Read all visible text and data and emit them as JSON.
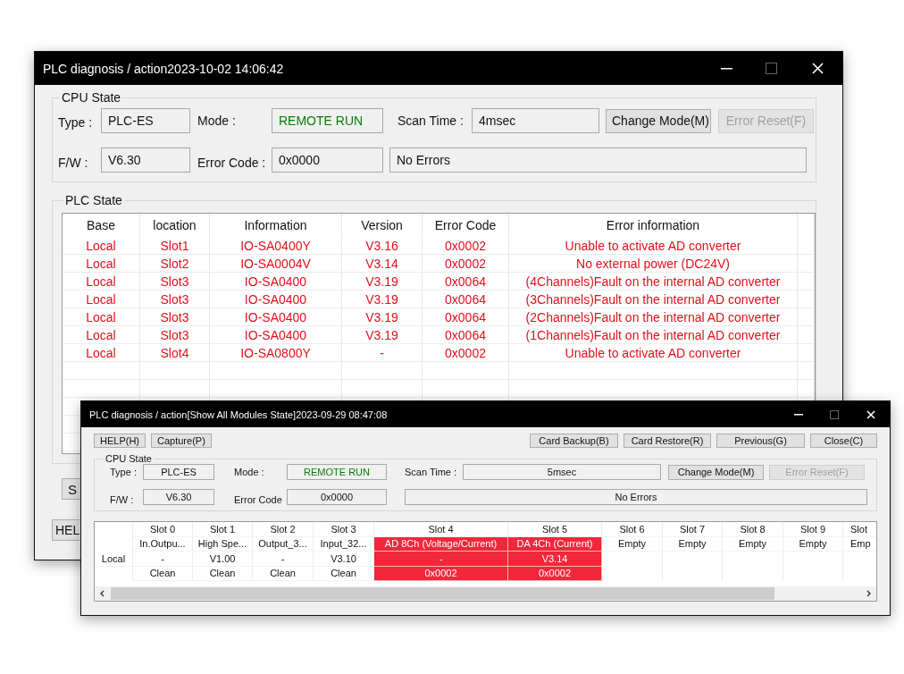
{
  "back_window": {
    "title": "PLC diagnosis / action2023-10-02 14:06:42",
    "cpu_state": {
      "group_title": "CPU State",
      "type_label": "Type :",
      "type_value": "PLC-ES",
      "mode_label": "Mode :",
      "mode_value": "REMOTE RUN",
      "scan_label": "Scan Time :",
      "scan_value": "4msec",
      "fw_label": "F/W :",
      "fw_value": "V6.30",
      "error_code_label": "Error Code :",
      "error_code_value": "0x0000",
      "error_text": "No Errors",
      "buttons": [
        {
          "label": "Change Mode(M)",
          "disabled": false
        },
        {
          "label": "Error Reset(F)",
          "disabled": true
        }
      ]
    },
    "plc_state": {
      "group_title": "PLC State",
      "columns": [
        "Base",
        "location",
        "Information",
        "Version",
        "Error Code",
        "Error information"
      ],
      "rows": [
        [
          "Local",
          "Slot1",
          "IO-SA0400Y",
          "V3.16",
          "0x0002",
          "Unable to activate AD converter"
        ],
        [
          "Local",
          "Slot2",
          "IO-SA0004V",
          "V3.14",
          "0x0002",
          "No external power (DC24V)"
        ],
        [
          "Local",
          "Slot3",
          "IO-SA0400",
          "V3.19",
          "0x0064",
          "(4Channels)Fault on the internal AD converter"
        ],
        [
          "Local",
          "Slot3",
          "IO-SA0400",
          "V3.19",
          "0x0064",
          "(3Channels)Fault on the internal AD converter"
        ],
        [
          "Local",
          "Slot3",
          "IO-SA0400",
          "V3.19",
          "0x0064",
          "(2Channels)Fault on the internal AD converter"
        ],
        [
          "Local",
          "Slot3",
          "IO-SA0400",
          "V3.19",
          "0x0064",
          "(1Channels)Fault on the internal AD converter"
        ],
        [
          "Local",
          "Slot4",
          "IO-SA0800Y",
          "-",
          "0x0002",
          "Unable to activate AD converter"
        ]
      ]
    },
    "bottom_buttons": [
      "S",
      "HEL"
    ]
  },
  "front_window": {
    "title": "PLC diagnosis / action[Show All Modules State]2023-09-29 08:47:08",
    "toolbar_left": [
      "HELP(H)",
      "Capture(P)"
    ],
    "toolbar_right": [
      "Card Backup(B)",
      "Card Restore(R)",
      "Previous(G)",
      "Close(C)"
    ],
    "cpu_state": {
      "group_title": "CPU State",
      "type_label": "Type :",
      "type_value": "PLC-ES",
      "mode_label": "Mode :",
      "mode_value": "REMOTE RUN",
      "scan_label": "Scan Time :",
      "scan_value": "5msec",
      "fw_label": "F/W :",
      "fw_value": "V6.30",
      "error_code_label": "Error Code",
      "error_code_value": "0x0000",
      "error_text": "No Errors",
      "buttons": [
        {
          "label": "Change Mode(M)",
          "disabled": false
        },
        {
          "label": "Error Reset(F)",
          "disabled": true
        }
      ]
    },
    "slots": {
      "row_label": "Local",
      "columns": [
        {
          "header": "Slot 0",
          "name": "In.Outpu...",
          "version": "-",
          "error_code": "Clean",
          "fault": false
        },
        {
          "header": "Slot 1",
          "name": "High Spe...",
          "version": "V1.00",
          "error_code": "Clean",
          "fault": false
        },
        {
          "header": "Slot 2",
          "name": "Output_3...",
          "version": "-",
          "error_code": "Clean",
          "fault": false
        },
        {
          "header": "Slot 3",
          "name": "Input_32...",
          "version": "V3.10",
          "error_code": "Clean",
          "fault": false
        },
        {
          "header": "Slot 4",
          "name": "AD 8Ch (Voltage/Current)",
          "version": "-",
          "error_code": "0x0002",
          "fault": true
        },
        {
          "header": "Slot 5",
          "name": "DA 4Ch (Current)",
          "version": "V3.14",
          "error_code": "0x0002",
          "fault": true
        },
        {
          "header": "Slot 6",
          "name": "Empty",
          "fault": false
        },
        {
          "header": "Slot 7",
          "name": "Empty",
          "fault": false
        },
        {
          "header": "Slot 8",
          "name": "Empty",
          "fault": false
        },
        {
          "header": "Slot 9",
          "name": "Empty",
          "fault": false
        },
        {
          "header": "Slot",
          "name": "Emp",
          "fault": false
        }
      ]
    }
  }
}
